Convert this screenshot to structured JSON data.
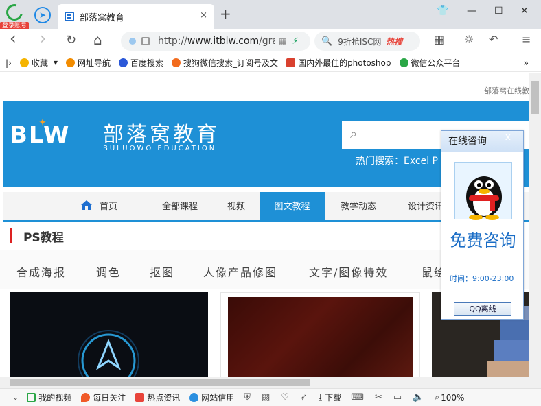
{
  "browser": {
    "badge": "登录账号",
    "tab_title": "部落窝教育",
    "tab_close": "×",
    "new_tab": "+",
    "url_prefix": "http://",
    "url_domain": "www.itblw.com",
    "url_rest": "/gra",
    "search_placeholder": "9折抢ISC网",
    "search_hot": "热搜",
    "nav_back": "‹",
    "nav_forward": "›",
    "nav_reload": "↻",
    "nav_home": "⌂"
  },
  "bookmarks": [
    {
      "label": "收藏",
      "color": "#f5b400"
    },
    {
      "label": "网址导航",
      "color": "#f28c00"
    },
    {
      "label": "百度搜索",
      "color": "#2b58d8"
    },
    {
      "label": "搜狗微信搜索_订阅号及文",
      "color": "#f26b1d"
    },
    {
      "label": "国内外最佳的photoshop",
      "color": "#d9412f"
    },
    {
      "label": "微信公众平台",
      "color": "#2aa646"
    }
  ],
  "page": {
    "top_note": "部落窝在线教",
    "brand_name": "部落窝教育",
    "brand_sub": "BULUOWO EDUCATION",
    "logo_text": "BLW",
    "hot_search_label": "热门搜索：",
    "hot_search_items": "Excel    P",
    "menu": [
      {
        "label": "首页"
      },
      {
        "label": "全部课程"
      },
      {
        "label": "视频"
      },
      {
        "label": "图文教程"
      },
      {
        "label": "教学动态"
      },
      {
        "label": "设计资讯"
      }
    ],
    "section_title": "PS教程",
    "categories": [
      "合成海报",
      "调色",
      "抠图",
      "人像产品修图",
      "文字/图像特效",
      "鼠绘"
    ]
  },
  "float_panel": {
    "title": "在线咨询",
    "close": "x",
    "free_label": "免费咨询",
    "time": "时间：9:00-23:00",
    "qq_button": "QQ离线"
  },
  "status": {
    "items": [
      {
        "label": "我的视频",
        "color": "#2aa646"
      },
      {
        "label": "每日关注",
        "color": "#f05a28"
      },
      {
        "label": "热点资讯",
        "color": "#e8443a"
      },
      {
        "label": "网站信用",
        "color": "#2b8fe0"
      }
    ],
    "download": "下载",
    "zoom": "100%"
  }
}
